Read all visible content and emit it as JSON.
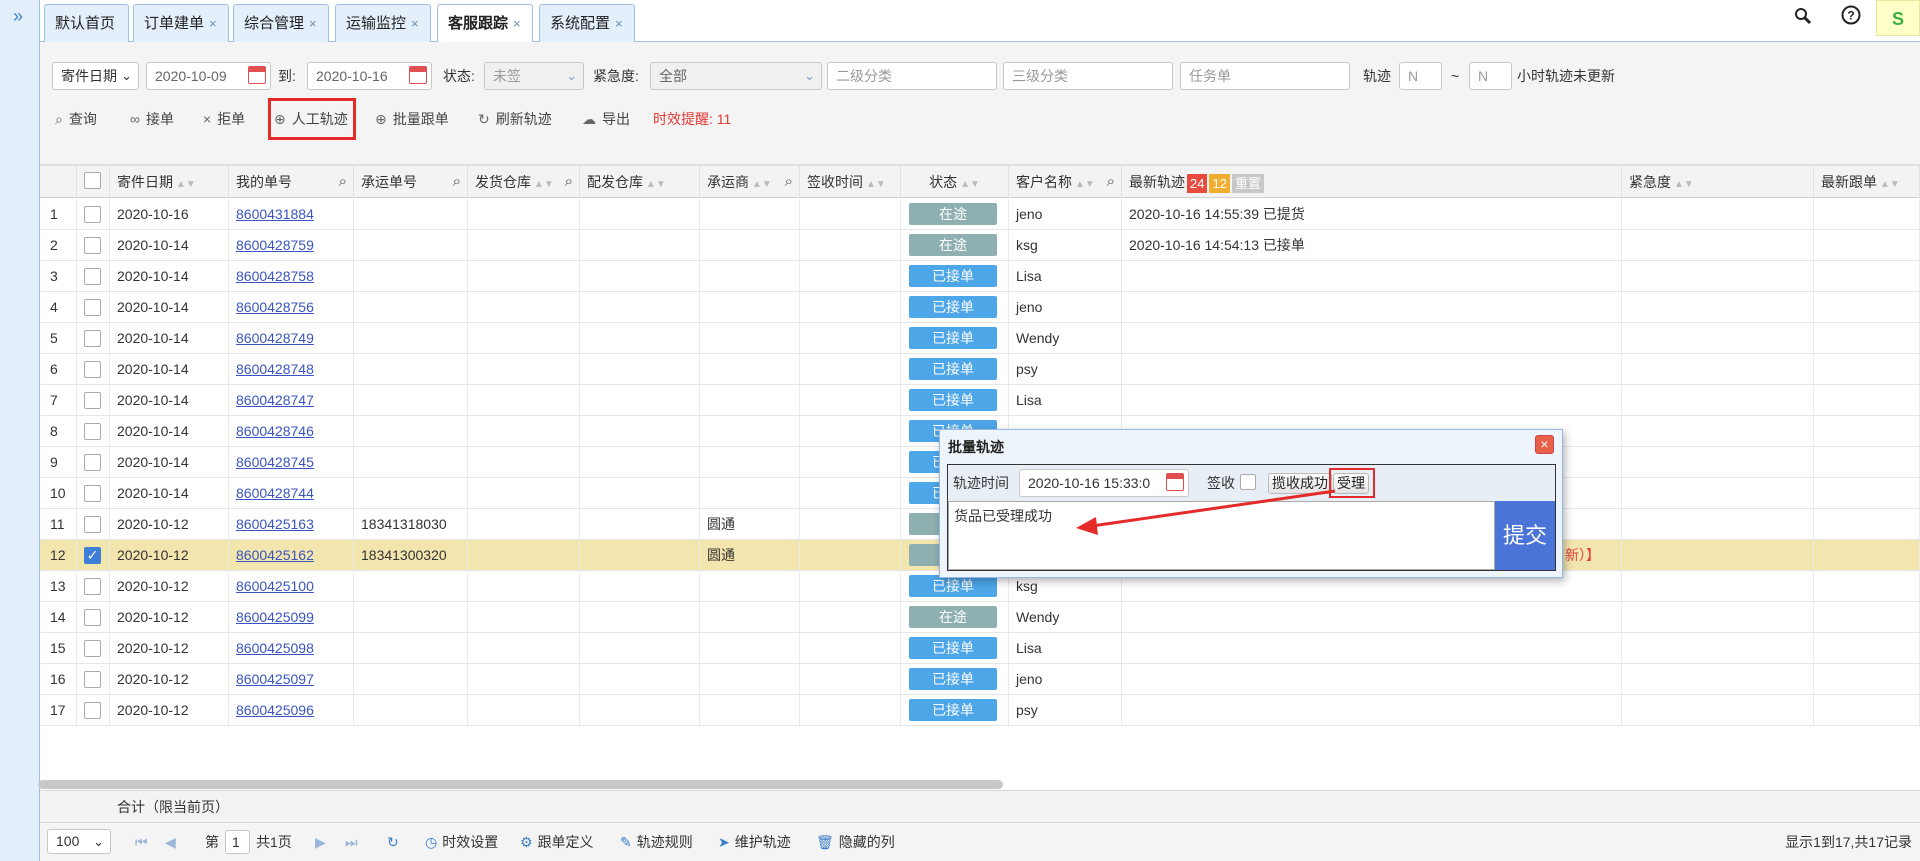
{
  "tabs": [
    {
      "label": "默认首页",
      "closable": false
    },
    {
      "label": "订单建单",
      "closable": true
    },
    {
      "label": "综合管理",
      "closable": true
    },
    {
      "label": "运输监控",
      "closable": true
    },
    {
      "label": "客服跟踪",
      "closable": true,
      "active": true
    },
    {
      "label": "系统配置",
      "closable": true
    }
  ],
  "tab_close_glyph": "×",
  "top_icons": {
    "search": "🔍",
    "help": "?",
    "theme": "S"
  },
  "filters": {
    "date_type": "寄件日期",
    "date_from": "2020-10-09",
    "to_label": "到:",
    "date_to": "2020-10-16",
    "status_label": "状态:",
    "status_value": "未签",
    "urgency_label": "紧急度:",
    "urgency_value": "全部",
    "cat2_placeholder": "二级分类",
    "cat3_placeholder": "三级分类",
    "task_placeholder": "任务单",
    "track_label": "轨迹",
    "track_from": "N",
    "tilde": "~",
    "track_to": "N",
    "track_suffix": "小时轨迹未更新"
  },
  "toolbar": {
    "query": "查询",
    "accept": "接单",
    "reject": "拒单",
    "manual_track": "人工轨迹",
    "batch_follow": "批量跟单",
    "refresh_track": "刷新轨迹",
    "export": "导出",
    "timeliness_alert": "时效提醒: 11"
  },
  "columns": {
    "ship_date": "寄件日期",
    "my_no": "我的单号",
    "carrier_no": "承运单号",
    "ship_wh": "发货仓库",
    "dist_wh": "配发仓库",
    "carrier": "承运商",
    "sign_time": "签收时间",
    "status": "状态",
    "customer": "客户名称",
    "latest_track": "最新轨迹",
    "badge_red": "24",
    "badge_orange": "12",
    "badge_gray": "重置",
    "urgency": "紧急度",
    "latest_follow": "最新跟单"
  },
  "rows": [
    {
      "n": "1",
      "date": "2020-10-16",
      "no": "8600431884",
      "carrier_no": "",
      "carrier": "",
      "status": "在途",
      "customer": "jeno",
      "track": "2020-10-16 14:55:39 已提货"
    },
    {
      "n": "2",
      "date": "2020-10-14",
      "no": "8600428759",
      "carrier_no": "",
      "carrier": "",
      "status": "在途",
      "customer": "ksg",
      "track": "2020-10-16 14:54:13 已接单"
    },
    {
      "n": "3",
      "date": "2020-10-14",
      "no": "8600428758",
      "carrier_no": "",
      "carrier": "",
      "status": "已接单",
      "customer": "Lisa",
      "track": ""
    },
    {
      "n": "4",
      "date": "2020-10-14",
      "no": "8600428756",
      "carrier_no": "",
      "carrier": "",
      "status": "已接单",
      "customer": "jeno",
      "track": ""
    },
    {
      "n": "5",
      "date": "2020-10-14",
      "no": "8600428749",
      "carrier_no": "",
      "carrier": "",
      "status": "已接单",
      "customer": "Wendy",
      "track": ""
    },
    {
      "n": "6",
      "date": "2020-10-14",
      "no": "8600428748",
      "carrier_no": "",
      "carrier": "",
      "status": "已接单",
      "customer": "psy",
      "track": ""
    },
    {
      "n": "7",
      "date": "2020-10-14",
      "no": "8600428747",
      "carrier_no": "",
      "carrier": "",
      "status": "已接单",
      "customer": "Lisa",
      "track": ""
    },
    {
      "n": "8",
      "date": "2020-10-14",
      "no": "8600428746",
      "carrier_no": "",
      "carrier": "",
      "status": "已接单",
      "customer": "",
      "track": ""
    },
    {
      "n": "9",
      "date": "2020-10-14",
      "no": "8600428745",
      "carrier_no": "",
      "carrier": "",
      "status": "已接单",
      "customer": "",
      "track": ""
    },
    {
      "n": "10",
      "date": "2020-10-14",
      "no": "8600428744",
      "carrier_no": "",
      "carrier": "",
      "status": "已接单",
      "customer": "",
      "track": ""
    },
    {
      "n": "11",
      "date": "2020-10-12",
      "no": "8600425163",
      "carrier_no": "18341318030",
      "carrier": "圆通",
      "status": "在途",
      "customer": "",
      "track": ""
    },
    {
      "n": "12",
      "date": "2020-10-12",
      "no": "8600425162",
      "carrier_no": "18341300320",
      "carrier": "圆通",
      "status": "在途",
      "customer": "",
      "track": "",
      "selected": true,
      "tail": "新）】"
    },
    {
      "n": "13",
      "date": "2020-10-12",
      "no": "8600425100",
      "carrier_no": "",
      "carrier": "",
      "status": "已接单",
      "customer": "ksg",
      "track": ""
    },
    {
      "n": "14",
      "date": "2020-10-12",
      "no": "8600425099",
      "carrier_no": "",
      "carrier": "",
      "status": "在途",
      "customer": "Wendy",
      "track": ""
    },
    {
      "n": "15",
      "date": "2020-10-12",
      "no": "8600425098",
      "carrier_no": "",
      "carrier": "",
      "status": "已接单",
      "customer": "Lisa",
      "track": ""
    },
    {
      "n": "16",
      "date": "2020-10-12",
      "no": "8600425097",
      "carrier_no": "",
      "carrier": "",
      "status": "已接单",
      "customer": "jeno",
      "track": ""
    },
    {
      "n": "17",
      "date": "2020-10-12",
      "no": "8600425096",
      "carrier_no": "",
      "carrier": "",
      "status": "已接单",
      "customer": "psy",
      "track": ""
    }
  ],
  "summary": "合计（限当前页）",
  "pager": {
    "page_size": "100",
    "page_prefix": "第",
    "page": "1",
    "page_suffix": "共1页",
    "timeliness_settings": "时效设置",
    "follow_def": "跟单定义",
    "track_rules": "轨迹规则",
    "maintain_track": "维护轨迹",
    "hidden_cols": "隐藏的列",
    "info": "显示1到17,共17记录"
  },
  "dialog": {
    "title": "批量轨迹",
    "track_time_label": "轨迹时间",
    "track_time_value": "2020-10-16 15:33:0",
    "sign_label": "签收",
    "btn_pickup": "揽收成功",
    "btn_accept": "受理",
    "text": "货品已受理成功",
    "submit": "提交"
  },
  "colors": {
    "highlight": "#e52a2a",
    "status_in_transit": "#8fb0b0",
    "status_accepted": "#4da6e8",
    "selected_row": "#f3e5ae",
    "submit": "#4a74d8",
    "alert_text": "#e53935"
  }
}
